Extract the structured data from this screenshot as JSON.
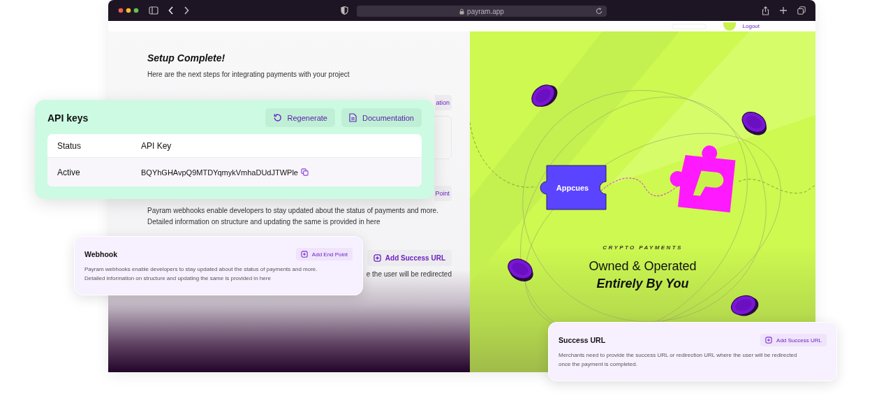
{
  "browser": {
    "url": "payram.app"
  },
  "header": {
    "logout": "Logout"
  },
  "setup": {
    "title": "Setup Complete!",
    "subtitle": "Here are the next steps for integrating payments with your project"
  },
  "behind": {
    "documentation_fragment": "ation",
    "endpoint_fragment": "Point",
    "webhook_lines": [
      "Payram webhooks enable developers to stay updated about the status of payments and more.",
      "Detailed information on structure and updating the same is provided in here"
    ],
    "success_button": "Add Success URL",
    "success_fragment": "e the user will be redirected"
  },
  "api_keys": {
    "title": "API keys",
    "buttons": [
      {
        "label": "Regenerate",
        "kind": "regenerate"
      },
      {
        "label": "Documentation",
        "kind": "document"
      }
    ],
    "columns": [
      "Status",
      "API Key"
    ],
    "rows": [
      {
        "status": "Active",
        "key": "BQYhGHAvpQ9MTDYqmykVmhaDUdJTWPle"
      }
    ]
  },
  "webhook": {
    "title": "Webhook",
    "button": "Add End Point",
    "lines": [
      "Payram webhooks enable developers to stay updated about the status of payments and more.",
      "Detailed information on structure and updating the same is provided in here"
    ]
  },
  "success_url": {
    "title": "Success URL",
    "button": "Add Success URL",
    "lines": [
      "Merchants need to provide the success URL or redirection URL where the user will be redirected",
      "once the payment is completed."
    ]
  },
  "promo": {
    "puzzle_label": "Appcues",
    "eyebrow": "CRYPTO PAYMENTS",
    "heading": "Owned & Operated",
    "heading_bold": "Entirely By You"
  }
}
